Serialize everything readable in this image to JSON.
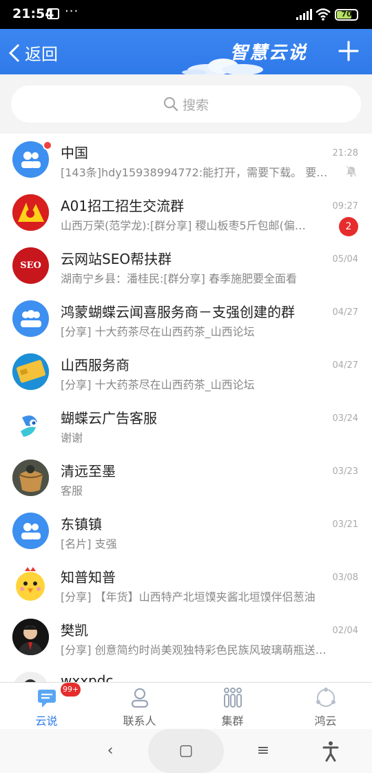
{
  "status_bar": {
    "time": "21:54",
    "dots": "···",
    "battery": "70"
  },
  "header": {
    "back_label": "返回",
    "brand": "智慧云说"
  },
  "search": {
    "placeholder": "搜索"
  },
  "conversations": [
    {
      "name": "中国",
      "preview": "[143条]hdy15938994772:能打开，需要下载。 要…",
      "time": "21:28",
      "avatar": "group-avatar",
      "muted": true,
      "unread_dot": true
    },
    {
      "name": "A01招工招生交流群",
      "preview": "山西万荣(范学龙):[群分享] 稷山板枣5斤包邮(偏…",
      "time": "09:27",
      "avatar": "red-logo-avatar",
      "badge": "2"
    },
    {
      "name": "云网站SEO帮扶群",
      "preview": "湖南宁乡县：潘桂民:[群分享] 春季施肥要全面看",
      "time": "05/04",
      "avatar": "seo-avatar",
      "avatar_text": "SEO"
    },
    {
      "name": "鸿蒙蝴蝶云闻喜服务商－支强创建的群",
      "preview": "[分享] 十大药茶尽在山西药茶_山西论坛",
      "time": "04/27",
      "avatar": "group-avatar"
    },
    {
      "name": "山西服务商",
      "preview": "[分享] 十大药茶尽在山西药茶_山西论坛",
      "time": "04/27",
      "avatar": "card-avatar"
    },
    {
      "name": "蝴蝶云广告客服",
      "preview": "谢谢",
      "time": "03/24",
      "avatar": "butterfly-avatar"
    },
    {
      "name": "清远至墨",
      "preview": "客服",
      "time": "03/23",
      "avatar": "photo-avatar"
    },
    {
      "name": "东镇镇",
      "preview": "[名片] 支强",
      "time": "03/21",
      "avatar": "group-avatar"
    },
    {
      "name": "知普知普",
      "preview": "[分享] 【年货】山西特产北垣馍夹酱北垣馍伴侣葱油",
      "time": "03/08",
      "avatar": "chick-avatar"
    },
    {
      "name": "樊凯",
      "preview": "[分享] 创意简约时尚美观独特彩色民族风玻璃萌瓶送…",
      "time": "02/04",
      "avatar": "person-avatar"
    },
    {
      "name": "wxxpdc",
      "preview": "",
      "time": "",
      "avatar": "person-avatar"
    }
  ],
  "tabs": [
    {
      "label": "云说",
      "icon": "chat-icon",
      "badge": "99+",
      "active": true
    },
    {
      "label": "联系人",
      "icon": "contacts-icon"
    },
    {
      "label": "集群",
      "icon": "cluster-icon"
    },
    {
      "label": "鸿云",
      "icon": "cloud-network-icon"
    }
  ],
  "nav": {
    "back": "‹",
    "home": "▢",
    "menu": "≡",
    "accessibility": "accessibility-icon"
  },
  "colors": {
    "accent": "#2f7ae9",
    "badge": "#e62c2c"
  }
}
